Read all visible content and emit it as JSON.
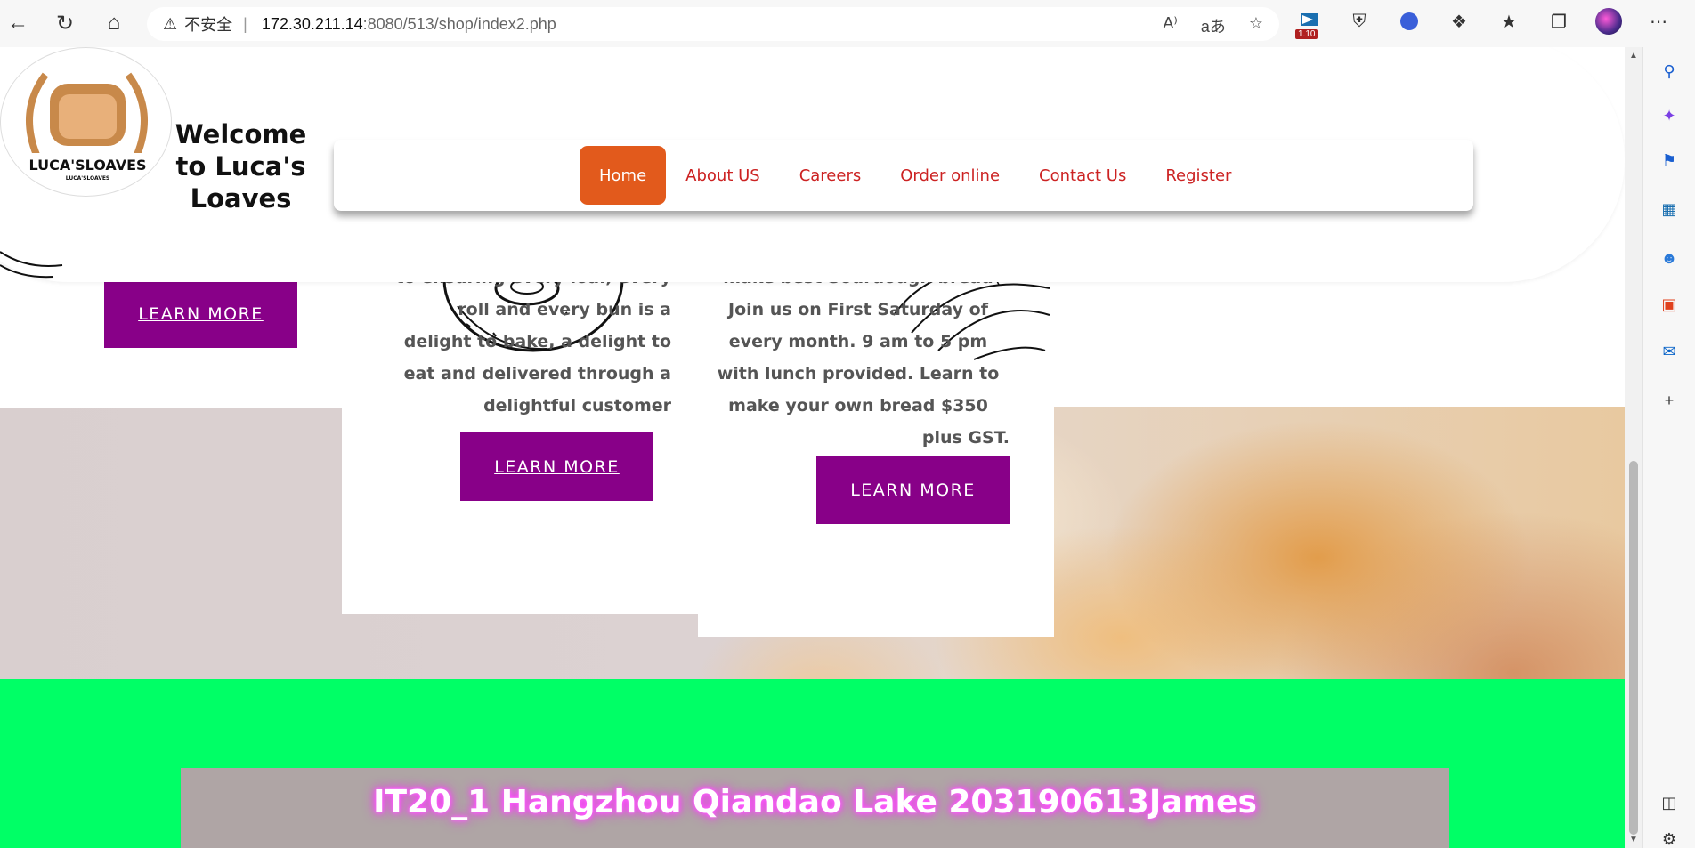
{
  "browser": {
    "security_label": "不安全",
    "url_host": "172.30.211.14",
    "url_rest": ":8080/513/shop/index2.php",
    "extension_badge": "1.10"
  },
  "header": {
    "logo_text": "LUCA'SLOAVES",
    "logo_subtext": "LUCA'SLOAVES",
    "welcome_line1": "Welcome",
    "welcome_line2": "to Luca's",
    "welcome_line3": "Loaves"
  },
  "nav": {
    "items": [
      {
        "label": "Home",
        "active": true
      },
      {
        "label": "About US"
      },
      {
        "label": "Careers"
      },
      {
        "label": "Order online"
      },
      {
        "label": "Contact Us"
      },
      {
        "label": "Register"
      }
    ]
  },
  "cards": {
    "card1_button": "LEARN MORE",
    "card2_lines": [
      "to ensuring every loaf, every",
      "roll and every bun is a",
      "delight to bake, a delight to",
      "eat and delivered through a",
      "delightful customer"
    ],
    "card2_button": "LEARN MORE",
    "card3_lines": [
      "make best Sourdough bread",
      "Join us on First Saturday of",
      "every month. 9 am to 5 pm",
      "with lunch provided. Learn to",
      "make your own bread $350",
      "plus GST."
    ],
    "card3_button": "LEARN MORE"
  },
  "footer": {
    "text": "IT20_1 Hangzhou Qiandao Lake 203190613James"
  },
  "colors": {
    "nav_active": "#e25a1c",
    "nav_link": "#cc2222",
    "button_purple": "#880088",
    "footer_green": "#00ff66",
    "footer_box": "#afa5a5"
  }
}
